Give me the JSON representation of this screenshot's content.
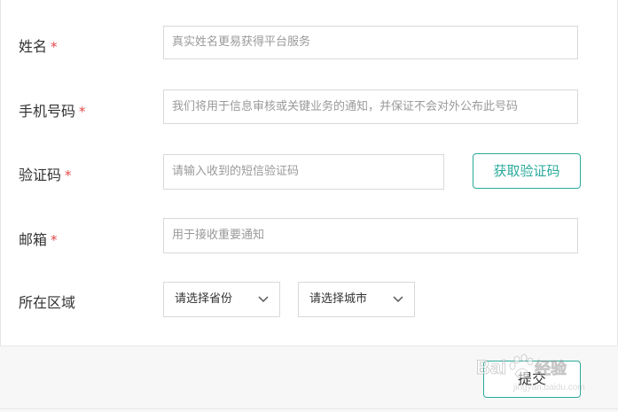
{
  "form": {
    "name": {
      "label": "姓名",
      "required_mark": "*",
      "placeholder": "真实姓名更易获得平台服务"
    },
    "phone": {
      "label": "手机号码",
      "required_mark": "*",
      "placeholder": "我们将用于信息审核或关键业务的通知，并保证不会对外公布此号码"
    },
    "code": {
      "label": "验证码",
      "required_mark": "*",
      "placeholder": "请输入收到的短信验证码",
      "button_label": "获取验证码"
    },
    "email": {
      "label": "邮箱",
      "required_mark": "*",
      "placeholder": "用于接收重要通知"
    },
    "region": {
      "label": "所在区域",
      "province_value": "请选择省份",
      "city_value": "请选择城市"
    }
  },
  "footer": {
    "submit_label": "提交"
  },
  "watermark": {
    "brand": "Bai",
    "suffix": "经验",
    "url": "jingyan.baidu.com"
  },
  "colors": {
    "accent": "#2aaa9b",
    "required": "#e34a4a",
    "border": "#d9d9d9",
    "placeholder": "#9a9a9a",
    "footer_bg": "#f7f7f7"
  }
}
